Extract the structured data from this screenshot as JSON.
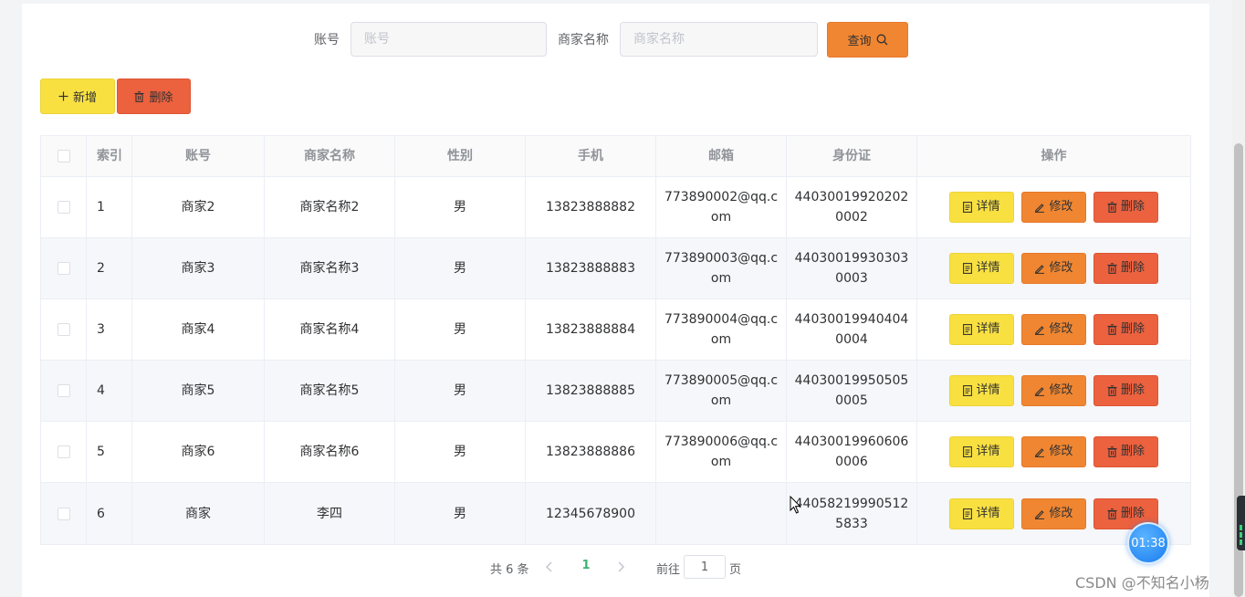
{
  "search": {
    "account_label": "账号",
    "account_placeholder": "账号",
    "merchant_label": "商家名称",
    "merchant_placeholder": "商家名称",
    "query_button": "查询"
  },
  "toolbar": {
    "add_button": "新增",
    "delete_button": "删除"
  },
  "table": {
    "headers": [
      "索引",
      "账号",
      "商家名称",
      "性别",
      "手机",
      "邮箱",
      "身份证",
      "操作"
    ],
    "rows": [
      {
        "index": "1",
        "account": "商家2",
        "name": "商家名称2",
        "gender": "男",
        "phone": "13823888882",
        "email": "773890002@qq.com",
        "id_card": "440300199202020002"
      },
      {
        "index": "2",
        "account": "商家3",
        "name": "商家名称3",
        "gender": "男",
        "phone": "13823888883",
        "email": "773890003@qq.com",
        "id_card": "440300199303030003"
      },
      {
        "index": "3",
        "account": "商家4",
        "name": "商家名称4",
        "gender": "男",
        "phone": "13823888884",
        "email": "773890004@qq.com",
        "id_card": "440300199404040004"
      },
      {
        "index": "4",
        "account": "商家5",
        "name": "商家名称5",
        "gender": "男",
        "phone": "13823888885",
        "email": "773890005@qq.com",
        "id_card": "440300199505050005"
      },
      {
        "index": "5",
        "account": "商家6",
        "name": "商家名称6",
        "gender": "男",
        "phone": "13823888886",
        "email": "773890006@qq.com",
        "id_card": "440300199606060006"
      },
      {
        "index": "6",
        "account": "商家",
        "name": "李四",
        "gender": "男",
        "phone": "12345678900",
        "email": "",
        "id_card": "440582199905125833"
      }
    ],
    "actions": {
      "detail": "详情",
      "edit": "修改",
      "delete": "删除"
    }
  },
  "pagination": {
    "total": "共 6 条",
    "current_page": "1",
    "goto_label": "前往",
    "goto_value": "1",
    "page_suffix": "页"
  },
  "overlay": {
    "timer": "01:38",
    "watermark": "CSDN @不知名小杨"
  },
  "colors": {
    "yellow_button": "#f9e041",
    "orange_button": "#f08631",
    "red_button": "#ec613e",
    "active_page": "#3cb371"
  },
  "icons": {
    "query": "search-icon",
    "add": "plus-icon",
    "delete": "trash-icon",
    "detail": "document-icon",
    "edit": "pencil-icon",
    "prev": "chevron-left-icon",
    "next": "chevron-right-icon"
  }
}
